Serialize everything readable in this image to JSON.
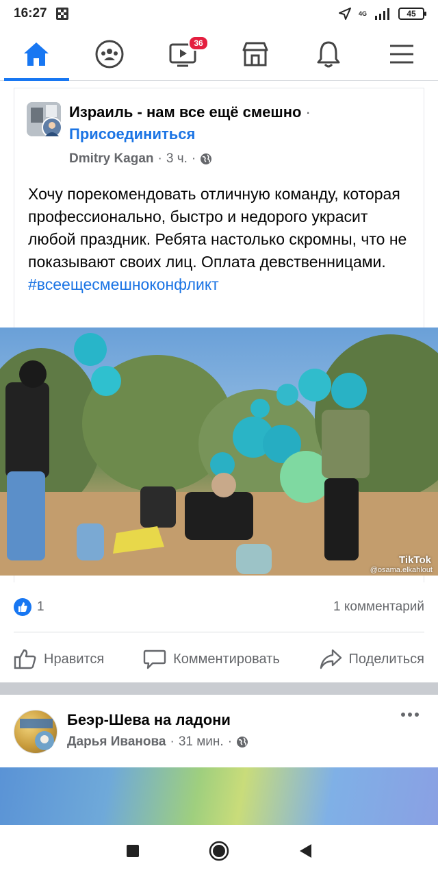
{
  "status_bar": {
    "time": "16:27",
    "network": "4G",
    "battery": "45"
  },
  "nav": {
    "tabs": [
      {
        "icon": "home-icon",
        "active": true
      },
      {
        "icon": "groups-icon",
        "active": false
      },
      {
        "icon": "watch-icon",
        "active": false,
        "badge": "36"
      },
      {
        "icon": "marketplace-icon",
        "active": false
      },
      {
        "icon": "bell-icon",
        "active": false
      },
      {
        "icon": "menu-icon",
        "active": false
      }
    ]
  },
  "post": {
    "group_name": "Израиль - нам все ещё смешно",
    "join_label": "Присоединиться",
    "author": "Dmitry Kagan",
    "time": "3 ч.",
    "text": "Хочу порекомендовать отличную команду, которая профессионально, быстро и недорого украсит любой праздник. Ребята настолько скромны, что не показывают своих лиц. Оплата девственницами.",
    "hashtag": "#всеещесмешноконфликт",
    "media": {
      "watermark": "TikTok",
      "handle": "@osama.elkahlout"
    },
    "likes": "1",
    "comments": "1 комментарий",
    "actions": {
      "like": "Нравится",
      "comment": "Комментировать",
      "share": "Поделиться"
    }
  },
  "post2": {
    "group_name": "Беэр-Шева на ладони",
    "author": "Дарья Иванова",
    "time": "31 мин."
  },
  "colors": {
    "accent": "#1877f2",
    "badge": "#e41e3f",
    "muted_text": "#65676b"
  }
}
